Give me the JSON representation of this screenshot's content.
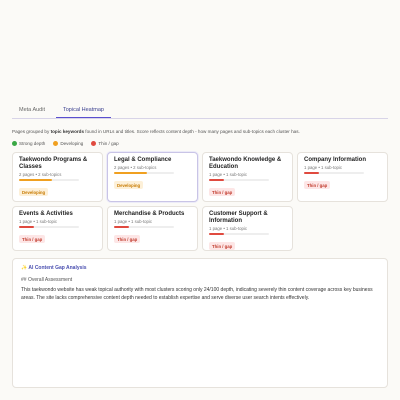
{
  "tabs": [
    {
      "label": "Meta Audit",
      "active": false
    },
    {
      "label": "Topical Heatmap",
      "active": true
    }
  ],
  "description": {
    "prefix": "Pages grouped by ",
    "bold": "topic keywords",
    "suffix": " found in URLs and titles. Score reflects content depth - how many pages and sub-topics each cluster has."
  },
  "legend": [
    {
      "label": "Strong depth",
      "color": "#3aa845"
    },
    {
      "label": "Developing",
      "color": "#f0a020"
    },
    {
      "label": "Thin / gap",
      "color": "#e04a3f"
    }
  ],
  "clusters": [
    {
      "title": "Taekwondo Programs & Classes",
      "sub": "2 pages • 2 sub-topics",
      "status": "Developing",
      "fill": 0.55,
      "selected": false
    },
    {
      "title": "Legal & Compliance",
      "sub": "2 pages • 2 sub-topics",
      "status": "Developing",
      "fill": 0.55,
      "selected": true
    },
    {
      "title": "Taekwondo Knowledge & Education",
      "sub": "1 page • 1 sub-topic",
      "status": "Thin / gap",
      "fill": 0.25,
      "selected": false
    },
    {
      "title": "Company Information",
      "sub": "1 page • 1 sub-topic",
      "status": "Thin / gap",
      "fill": 0.25,
      "selected": false
    },
    {
      "title": "Events & Activities",
      "sub": "1 page • 1 sub-topic",
      "status": "Thin / gap",
      "fill": 0.25,
      "selected": false
    },
    {
      "title": "Merchandise & Products",
      "sub": "1 page • 1 sub-topic",
      "status": "Thin / gap",
      "fill": 0.25,
      "selected": false
    },
    {
      "title": "Customer Support & Information",
      "sub": "1 page • 1 sub-topic",
      "status": "Thin / gap",
      "fill": 0.25,
      "selected": false
    }
  ],
  "status_colors": {
    "Developing": "#f0a020",
    "Thin / gap": "#e04a3f",
    "Strong depth": "#3aa845"
  },
  "analysis": {
    "heading": "✨ AI Content Gap Analysis",
    "section": "## Overall Assessment",
    "body": "This taekwondo website has weak topical authority with most clusters scoring only 24/100 depth, indicating severely thin content coverage across key business areas. The site lacks comprehensive content depth needed to establish expertise and serve diverse user search intents effectively."
  }
}
